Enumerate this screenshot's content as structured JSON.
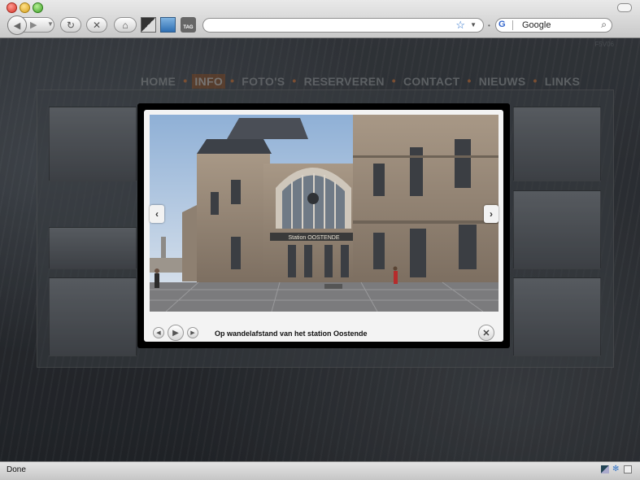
{
  "browser": {
    "search_engine": "Google",
    "search_placeholder": "Google",
    "status": "Done",
    "tool_icon_tag": "TAG"
  },
  "site": {
    "menu": [
      "HOME",
      "INFO",
      "FOTO'S",
      "RESERVEREN",
      "CONTACT",
      "NIEUWS",
      "LINKS"
    ],
    "active_menu": "INFO",
    "corner_text": "F5V06",
    "accent_color": "#8c5028"
  },
  "lightbox": {
    "caption": "Op wandelafstand van het station Oostende",
    "photo_sign": "Station OOSTENDE",
    "icons": {
      "prev": "chevron-left-icon",
      "next": "chevron-right-icon",
      "play": "play-icon",
      "close": "close-icon"
    }
  }
}
